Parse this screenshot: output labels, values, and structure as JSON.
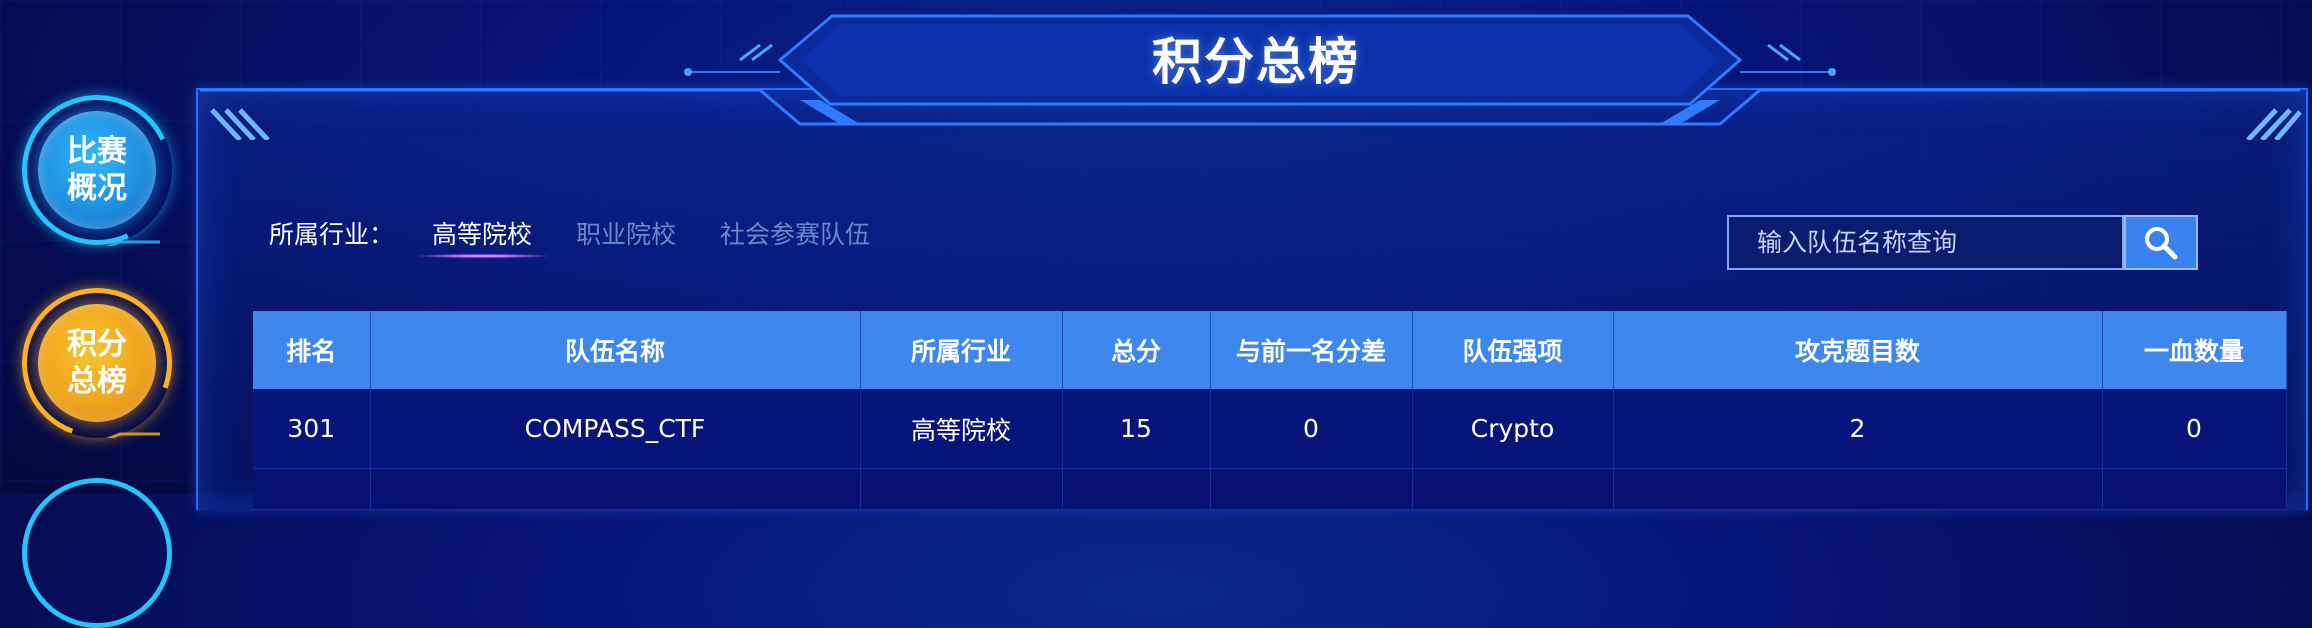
{
  "page": {
    "title": "积分总榜"
  },
  "nav": {
    "items": [
      {
        "label": "比赛概况",
        "line1": "比赛",
        "line2": "概况",
        "color": "#21c6ff"
      },
      {
        "label": "积分总榜",
        "line1": "积分",
        "line2": "总榜",
        "color": "#ffb021"
      }
    ]
  },
  "filter": {
    "label": "所属行业：",
    "tabs": [
      {
        "label": "高等院校",
        "active": true
      },
      {
        "label": "职业院校",
        "active": false
      },
      {
        "label": "社会参赛队伍",
        "active": false
      }
    ]
  },
  "search": {
    "placeholder": "输入队伍名称查询",
    "value": "",
    "icon": "search-icon"
  },
  "table": {
    "headers": [
      "排名",
      "队伍名称",
      "所属行业",
      "总分",
      "与前一名分差",
      "队伍强项",
      "攻克题目数",
      "一血数量"
    ],
    "rows": [
      [
        "301",
        "COMPASS_CTF",
        "高等院校",
        "15",
        "0",
        "Crypto",
        "2",
        "0"
      ]
    ]
  },
  "colors": {
    "accent": "#3d87ee",
    "background": "#07157a",
    "border": "#2a6bff"
  }
}
